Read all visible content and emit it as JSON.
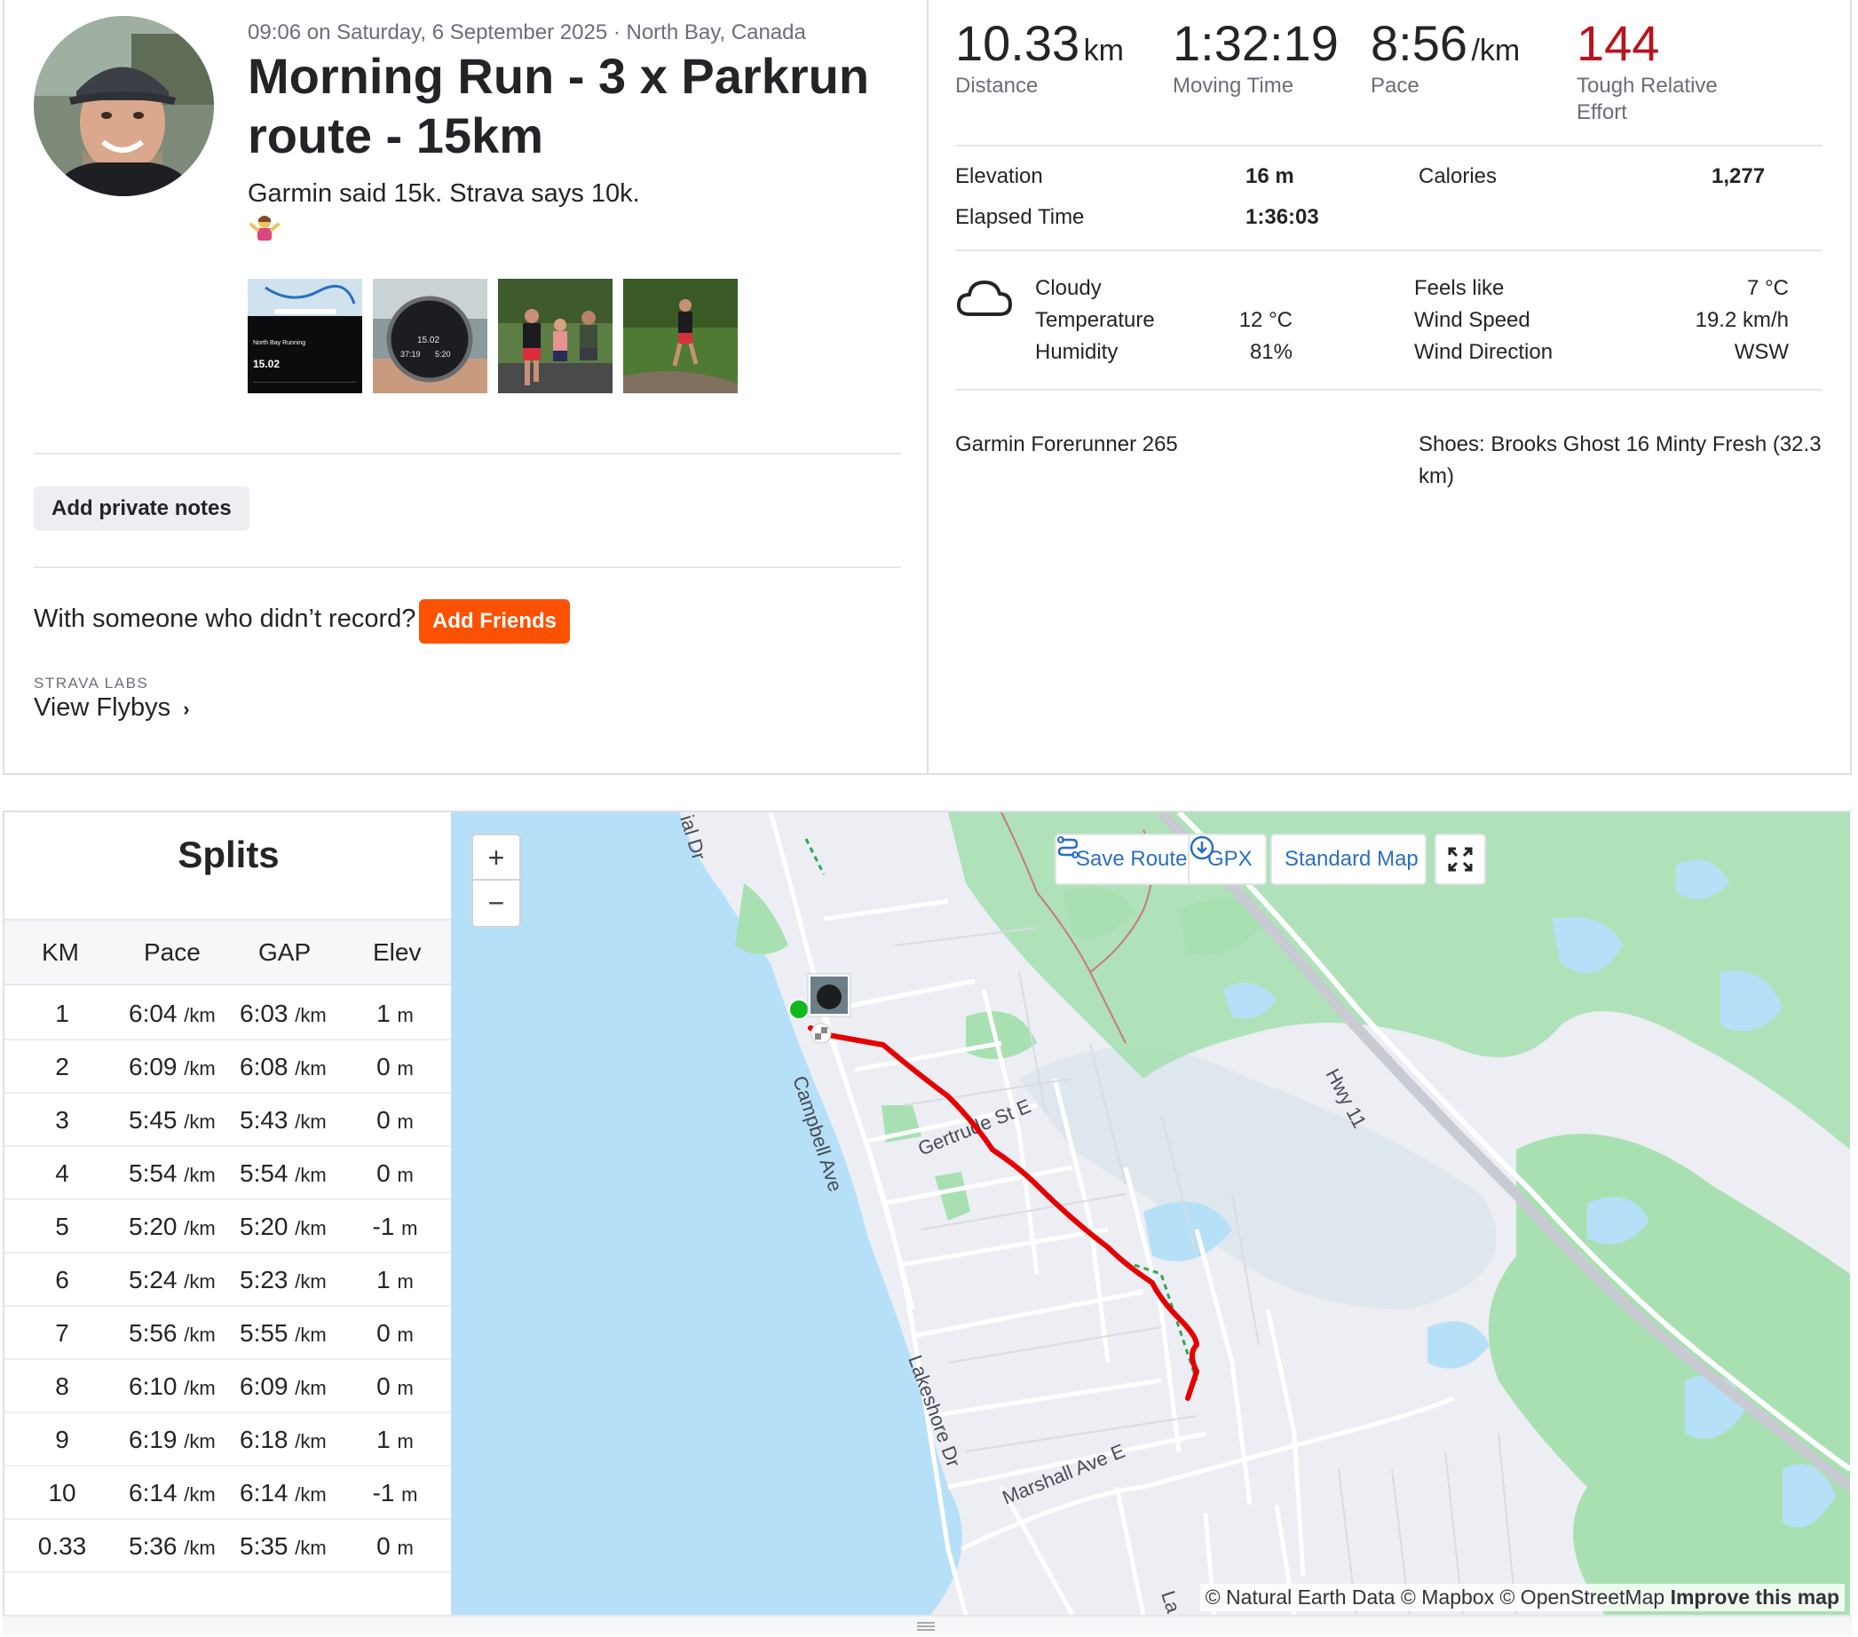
{
  "activity": {
    "meta": "09:06 on Saturday, 6 September 2025 · North Bay, Canada",
    "title": "Morning Run - 3 x Parkrun route - 15km",
    "description": "Garmin said 15k. Strava says 10k.",
    "description_emoji": "🤷‍♀️"
  },
  "actions": {
    "private_notes": "Add private notes",
    "with_someone": "With someone who didn’t record?",
    "add_friends": "Add Friends",
    "labs_label": "STRAVA LABS",
    "flybys": "View Flybys"
  },
  "photos": [
    {
      "name": "watch-summary",
      "texts": [
        "North Bay Running",
        "15.02"
      ]
    },
    {
      "name": "watch-face",
      "texts": [
        "15.02",
        "37:19",
        "5:20"
      ]
    },
    {
      "name": "runners-group"
    },
    {
      "name": "runner-park"
    }
  ],
  "stats": {
    "distance": {
      "value": "10.33",
      "unit": "km",
      "label": "Distance"
    },
    "moving_time": {
      "value": "1:32:19",
      "label": "Moving Time"
    },
    "pace": {
      "value": "8:56",
      "unit": "/km",
      "label": "Pace"
    },
    "effort": {
      "value": "144",
      "label": "Tough Relative Effort",
      "color": "#b9131e"
    }
  },
  "details": {
    "elevation_label": "Elevation",
    "elevation": "16 m",
    "calories_label": "Calories",
    "calories": "1,277",
    "elapsed_label": "Elapsed Time",
    "elapsed": "1:36:03"
  },
  "weather": {
    "condition": "Cloudy",
    "temperature_label": "Temperature",
    "temperature": "12 °C",
    "humidity_label": "Humidity",
    "humidity": "81%",
    "feels_label": "Feels like",
    "feels": "7 °C",
    "wind_speed_label": "Wind Speed",
    "wind_speed": "19.2 km/h",
    "wind_dir_label": "Wind Direction",
    "wind_dir": "WSW"
  },
  "gear": {
    "device": "Garmin Forerunner 265",
    "shoes_line1": "Shoes: Brooks Ghost 16 Minty Fresh (32.3",
    "shoes_line2": "km)"
  },
  "splits": {
    "title": "Splits",
    "headers": [
      "KM",
      "Pace",
      "GAP",
      "Elev"
    ],
    "unit_pace": "/km",
    "rows": [
      {
        "km": "1",
        "pace": "6:04",
        "gap": "6:03",
        "elev": "1",
        "elev_unit": "m"
      },
      {
        "km": "2",
        "pace": "6:09",
        "gap": "6:08",
        "elev": "0",
        "elev_unit": "m"
      },
      {
        "km": "3",
        "pace": "5:45",
        "gap": "5:43",
        "elev": "0",
        "elev_unit": "m"
      },
      {
        "km": "4",
        "pace": "5:54",
        "gap": "5:54",
        "elev": "0",
        "elev_unit": "m"
      },
      {
        "km": "5",
        "pace": "5:20",
        "gap": "5:20",
        "elev": "-1",
        "elev_unit": "m"
      },
      {
        "km": "6",
        "pace": "5:24",
        "gap": "5:23",
        "elev": "1",
        "elev_unit": "m"
      },
      {
        "km": "7",
        "pace": "5:56",
        "gap": "5:55",
        "elev": "0",
        "elev_unit": "m"
      },
      {
        "km": "8",
        "pace": "6:10",
        "gap": "6:09",
        "elev": "0",
        "elev_unit": "m"
      },
      {
        "km": "9",
        "pace": "6:19",
        "gap": "6:18",
        "elev": "1",
        "elev_unit": "m"
      },
      {
        "km": "10",
        "pace": "6:14",
        "gap": "6:14",
        "elev": "-1",
        "elev_unit": "m"
      },
      {
        "km": "0.33",
        "pace": "5:36",
        "gap": "5:35",
        "elev": "0",
        "elev_unit": "m"
      }
    ]
  },
  "map": {
    "zoom_in": "+",
    "zoom_out": "−",
    "save_route": "Save Route",
    "gpx": "GPX",
    "map_style": "Standard Map",
    "attribution": "© Natural Earth Data © Mapbox © OpenStreetMap",
    "improve": "Improve this map",
    "street_labels": [
      "ial Dr",
      "Campbell Ave",
      "Gertrude St E",
      "Hwy 11",
      "Lakeshore Dr",
      "Marshall Ave E",
      "La"
    ],
    "route_color": "#e60000",
    "water_color": "#b6e0f8",
    "park_color": "#a9e0b2"
  }
}
